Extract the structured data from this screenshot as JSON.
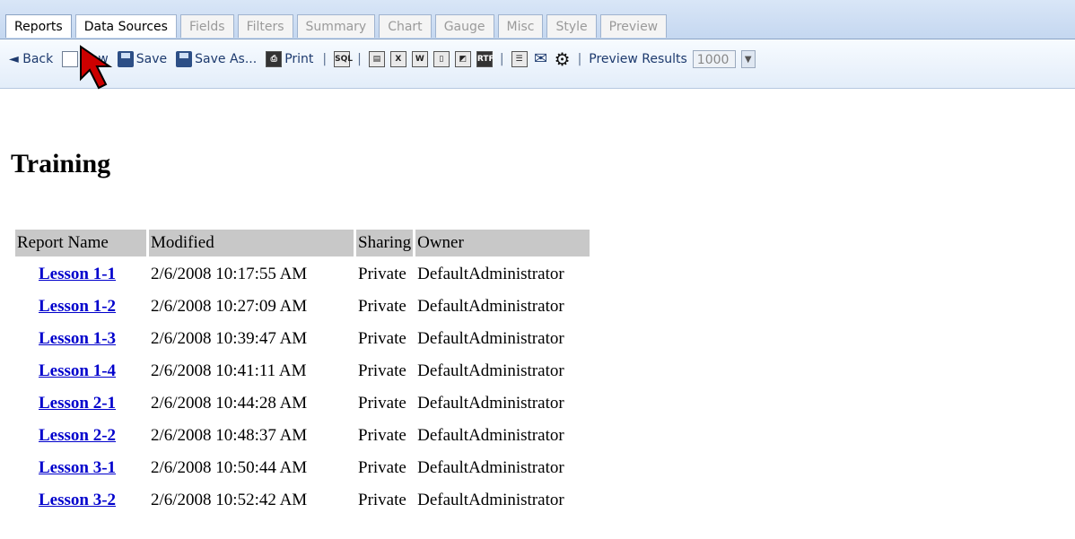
{
  "tabs": [
    {
      "label": "Reports"
    },
    {
      "label": "Data Sources"
    },
    {
      "label": "Fields"
    },
    {
      "label": "Filters"
    },
    {
      "label": "Summary"
    },
    {
      "label": "Chart"
    },
    {
      "label": "Gauge"
    },
    {
      "label": "Misc"
    },
    {
      "label": "Style"
    },
    {
      "label": "Preview"
    }
  ],
  "toolbar": {
    "back_label": "◄ Back",
    "new_label": "New",
    "save_label": "Save",
    "save_as_label": "Save As...",
    "print_label": "Print",
    "sql_icon_text": "SQL",
    "excel_icon_text": "X",
    "word_icon_text": "W",
    "rtf_icon_text": "RTF",
    "preview_results_label": "Preview Results",
    "preview_results_value": "1000"
  },
  "page": {
    "title": "Training"
  },
  "table": {
    "headers": [
      "Report Name",
      "Modified",
      "Sharing",
      "Owner"
    ],
    "rows": [
      {
        "name": "Lesson 1-1",
        "modified": "2/6/2008 10:17:55 AM",
        "sharing": "Private",
        "owner": "DefaultAdministrator"
      },
      {
        "name": "Lesson 1-2",
        "modified": "2/6/2008 10:27:09 AM",
        "sharing": "Private",
        "owner": "DefaultAdministrator"
      },
      {
        "name": "Lesson 1-3",
        "modified": "2/6/2008 10:39:47 AM",
        "sharing": "Private",
        "owner": "DefaultAdministrator"
      },
      {
        "name": "Lesson 1-4",
        "modified": "2/6/2008 10:41:11 AM",
        "sharing": "Private",
        "owner": "DefaultAdministrator"
      },
      {
        "name": "Lesson 2-1",
        "modified": "2/6/2008 10:44:28 AM",
        "sharing": "Private",
        "owner": "DefaultAdministrator"
      },
      {
        "name": "Lesson 2-2",
        "modified": "2/6/2008 10:48:37 AM",
        "sharing": "Private",
        "owner": "DefaultAdministrator"
      },
      {
        "name": "Lesson 3-1",
        "modified": "2/6/2008 10:50:44 AM",
        "sharing": "Private",
        "owner": "DefaultAdministrator"
      },
      {
        "name": "Lesson 3-2",
        "modified": "2/6/2008 10:52:42 AM",
        "sharing": "Private",
        "owner": "DefaultAdministrator"
      }
    ]
  },
  "colors": {
    "link": "#0000cc",
    "header_bg": "#c8c8c8",
    "toolbar_text": "#1d3a6e"
  }
}
